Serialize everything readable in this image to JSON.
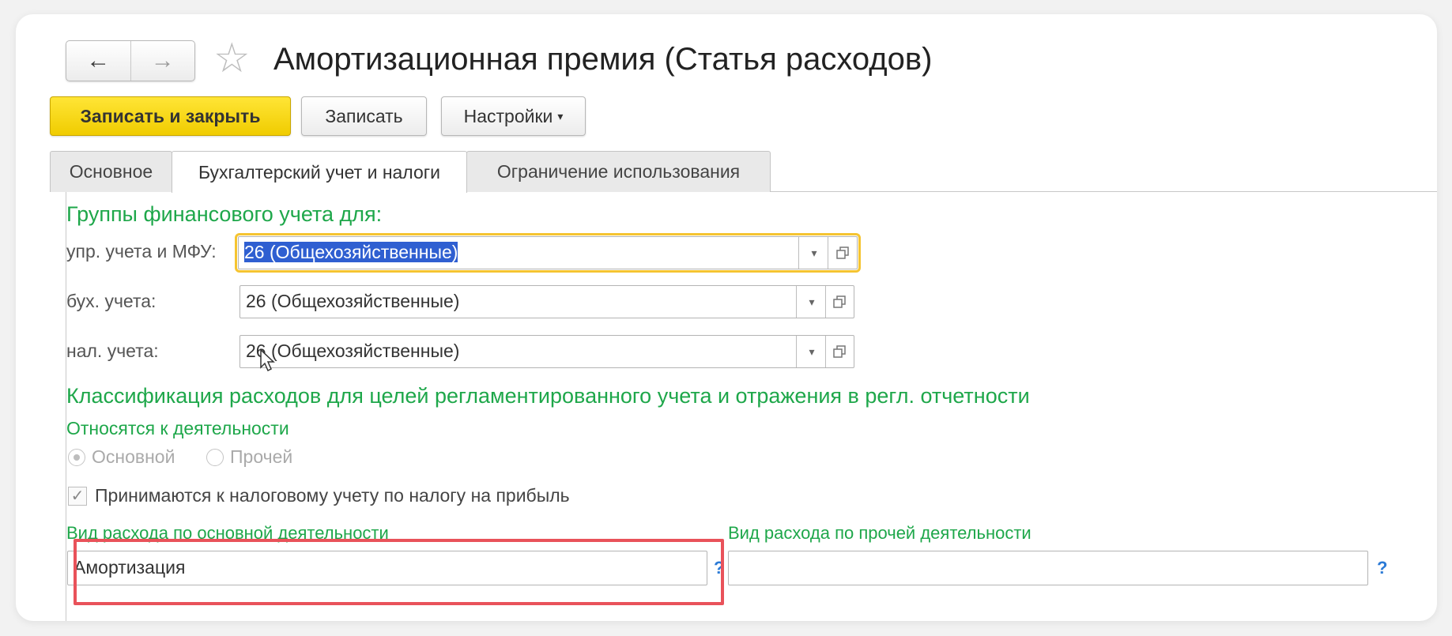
{
  "window": {
    "title": "Амортизационная премия (Статья расходов)"
  },
  "nav": {
    "back_icon": "←",
    "forward_icon": "→",
    "favorite_icon": "☆"
  },
  "toolbar": {
    "save_close": "Записать и закрыть",
    "save": "Записать",
    "settings": "Настройки",
    "settings_caret": "▾"
  },
  "tabs": [
    {
      "label": "Основное"
    },
    {
      "label": "Бухгалтерский учет и налоги"
    },
    {
      "label": "Ограничение использования"
    }
  ],
  "groups": {
    "heading": "Группы финансового учета для:",
    "rows": [
      {
        "label": "упр. учета и МФУ:",
        "value": "26 (Общехозяйственные)"
      },
      {
        "label": "бух. учета:",
        "value": "26 (Общехозяйственные)"
      },
      {
        "label": "нал. учета:",
        "value": "26 (Общехозяйственные)"
      }
    ]
  },
  "classification": {
    "heading": "Классификация расходов для целей регламентированного учета и отражения в регл. отчетности",
    "activity_label": "Относятся к деятельности",
    "radio_main": "Основной",
    "radio_other": "Прочей",
    "checkbox_label": "Принимаются к налоговому учету по налогу на прибыль",
    "main_expense_label": "Вид расхода по основной деятельности",
    "main_expense_value": "Амортизация",
    "other_expense_label": "Вид расхода по прочей деятельности",
    "other_expense_value": "",
    "help_icon": "?"
  },
  "colors": {
    "accent_green": "#1ea74a",
    "primary_yellow": "#f0cc00",
    "highlight_red": "#e9525a",
    "focus_yellow": "#f5c431",
    "selection_blue": "#2f5fd1"
  }
}
